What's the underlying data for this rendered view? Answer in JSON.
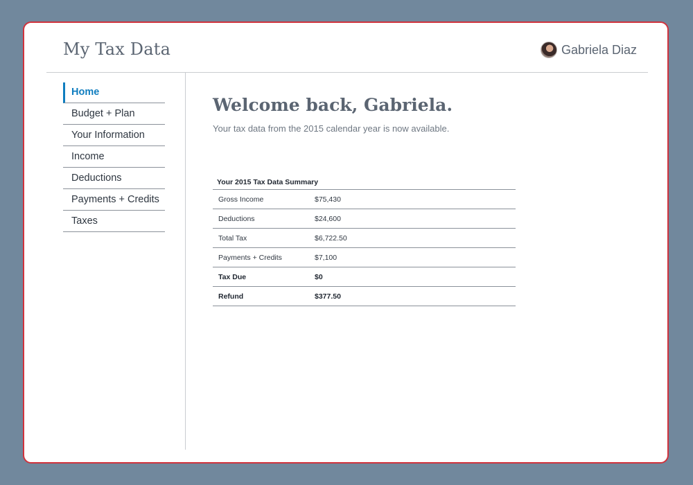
{
  "header": {
    "title": "My Tax Data",
    "user": {
      "name": "Gabriela Diaz",
      "avatar": "avatar-photo"
    }
  },
  "sidebar": {
    "items": [
      {
        "label": "Home",
        "active": true
      },
      {
        "label": "Budget + Plan"
      },
      {
        "label": "Your Information"
      },
      {
        "label": "Income"
      },
      {
        "label": "Deductions"
      },
      {
        "label": "Payments + Credits"
      },
      {
        "label": "Taxes"
      }
    ]
  },
  "main": {
    "heading": "Welcome back, Gabriela.",
    "subtitle": "Your tax data from the 2015 calendar year is now available.",
    "summary": {
      "title": "Your 2015 Tax Data Summary",
      "rows": [
        {
          "label": "Gross Income",
          "value": "$75,430"
        },
        {
          "label": "Deductions",
          "value": "$24,600"
        },
        {
          "label": "Total Tax",
          "value": "$6,722.50"
        },
        {
          "label": "Payments + Credits",
          "value": "$7,100"
        },
        {
          "label": "Tax Due",
          "value": "$0"
        },
        {
          "label": "Refund",
          "value": "$377.50"
        }
      ]
    }
  },
  "colors": {
    "background": "#71889d",
    "frame_border": "#d0323c",
    "accent": "#0f7dbf",
    "heading_text": "#5b6572"
  }
}
